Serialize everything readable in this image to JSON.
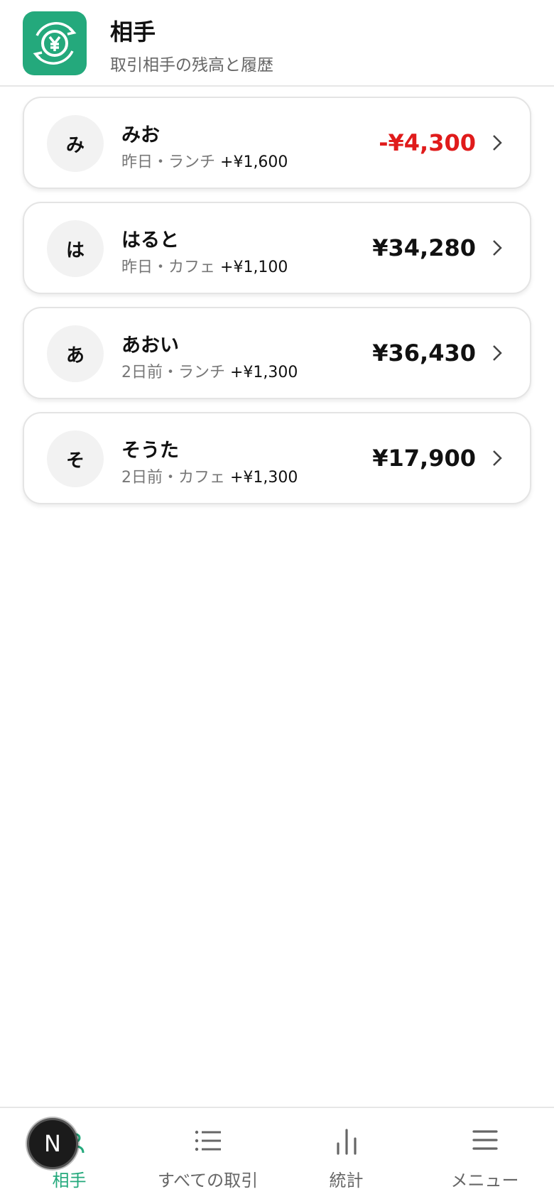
{
  "header": {
    "title": "相手",
    "subtitle": "取引相手の残高と履歴",
    "icon": "yen-exchange-icon",
    "accent_color": "#24a97c"
  },
  "contacts": [
    {
      "initial": "み",
      "name": "みお",
      "meta": "昨日・ランチ",
      "last_amount": "+¥1,600",
      "balance": "-¥4,300",
      "negative": true
    },
    {
      "initial": "は",
      "name": "はると",
      "meta": "昨日・カフェ",
      "last_amount": "+¥1,100",
      "balance": "¥34,280",
      "negative": false
    },
    {
      "initial": "あ",
      "name": "あおい",
      "meta": "2日前・ランチ",
      "last_amount": "+¥1,300",
      "balance": "¥36,430",
      "negative": false
    },
    {
      "initial": "そ",
      "name": "そうた",
      "meta": "2日前・カフェ",
      "last_amount": "+¥1,300",
      "balance": "¥17,900",
      "negative": false
    }
  ],
  "tabs": [
    {
      "label": "相手",
      "icon": "people-icon",
      "active": true
    },
    {
      "label": "すべての取引",
      "icon": "list-icon",
      "active": false
    },
    {
      "label": "統計",
      "icon": "bar-chart-icon",
      "active": false
    },
    {
      "label": "メニュー",
      "icon": "hamburger-menu-icon",
      "active": false
    }
  ],
  "dev_badge": {
    "letter": "N"
  },
  "colors": {
    "negative": "#e01b1b",
    "muted": "#777777"
  }
}
